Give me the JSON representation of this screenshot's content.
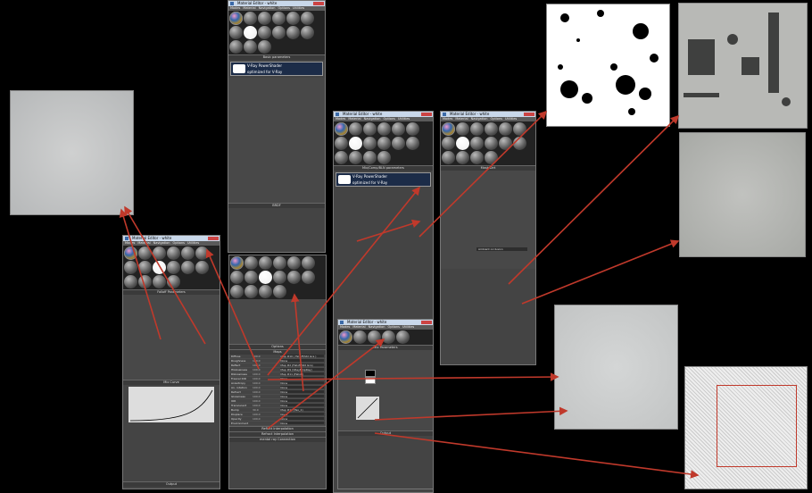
{
  "windows": {
    "top_center": {
      "title": "Material Editor - white",
      "menu": [
        "Modes",
        "Material",
        "Navigation",
        "Options",
        "Utilities"
      ],
      "rollout_basic": "Basic parameters",
      "vray_banner": "V-Ray PowerShader",
      "vray_sub": "optimized for V-Ray",
      "brdf": "BRDF"
    },
    "left": {
      "title": "Material Editor - white",
      "menu": [
        "Modes",
        "Material",
        "Navigation",
        "Options",
        "Utilities"
      ],
      "rollout_falloff": "Falloff Parameters",
      "mix_curve": "Mix Curve",
      "output": "Output"
    },
    "center_tall": {
      "rollout_options": "Options",
      "rollout_maps": "Maps",
      "map_rows": [
        {
          "name": "Diffuse",
          "val": "100.0",
          "map": "Map #10 ( Falloff/Std Gra )"
        },
        {
          "name": "Roughness",
          "val": "100.0",
          "map": "None"
        },
        {
          "name": "Reflect",
          "val": "100.0",
          "map": "Map #2 (Falloff/Std Gra)"
        },
        {
          "name": "HGlossiness",
          "val": "100.0",
          "map": "Map #9 (VRayBmpRay)"
        },
        {
          "name": "RGlossiness",
          "val": "100.0",
          "map": "Map #11 (Falloff)"
        },
        {
          "name": "Fresnel IOR",
          "val": "100.0",
          "map": "None"
        },
        {
          "name": "Anisotropy",
          "val": "100.0",
          "map": "None"
        },
        {
          "name": "An. rotation",
          "val": "100.0",
          "map": "None"
        },
        {
          "name": "Refract",
          "val": "100.0",
          "map": "None"
        },
        {
          "name": "Glossiness",
          "val": "100.0",
          "map": "None"
        },
        {
          "name": "IOR",
          "val": "100.0",
          "map": "None"
        },
        {
          "name": "Translucent",
          "val": "100.0",
          "map": "None"
        },
        {
          "name": "Bump",
          "val": "30.0",
          "map": "Map #13 (Tex_1)"
        },
        {
          "name": "Displace",
          "val": "100.0",
          "map": "None"
        },
        {
          "name": "Opacity",
          "val": "100.0",
          "map": "None"
        },
        {
          "name": "Environment",
          "val": "",
          "map": "None"
        }
      ],
      "reflect_interp": "Reflect Interpolation",
      "refract_interp": "Refract Interpolation",
      "mental_ray": "mental ray Connection"
    },
    "mid_right": {
      "title": "Material Editor - white",
      "menu": [
        "Modes",
        "Material",
        "Navigation",
        "Options",
        "Utilities"
      ],
      "rollout": "Mix/Comp/BLN parameters",
      "vray_banner": "V-Ray PowerShader",
      "vray_sub": "optimized for V-Ray"
    },
    "far_right": {
      "title": "Material Editor - white",
      "menu": [
        "Modes",
        "Material",
        "Navigation",
        "Options",
        "Utilities"
      ],
      "rollout": "Mask/Dirt",
      "option_label": "Ambient occlusion"
    },
    "bottom_right": {
      "title": "Material Editor - white",
      "menu": [
        "Modes",
        "Material",
        "Navigation",
        "Options",
        "Utilities"
      ],
      "rollout_mix": "Mix Parameters",
      "output": "Output"
    }
  },
  "colors": {
    "arrow": "#c0392b",
    "window_bg": "#444444",
    "title_bg": "#c9d8ea"
  }
}
